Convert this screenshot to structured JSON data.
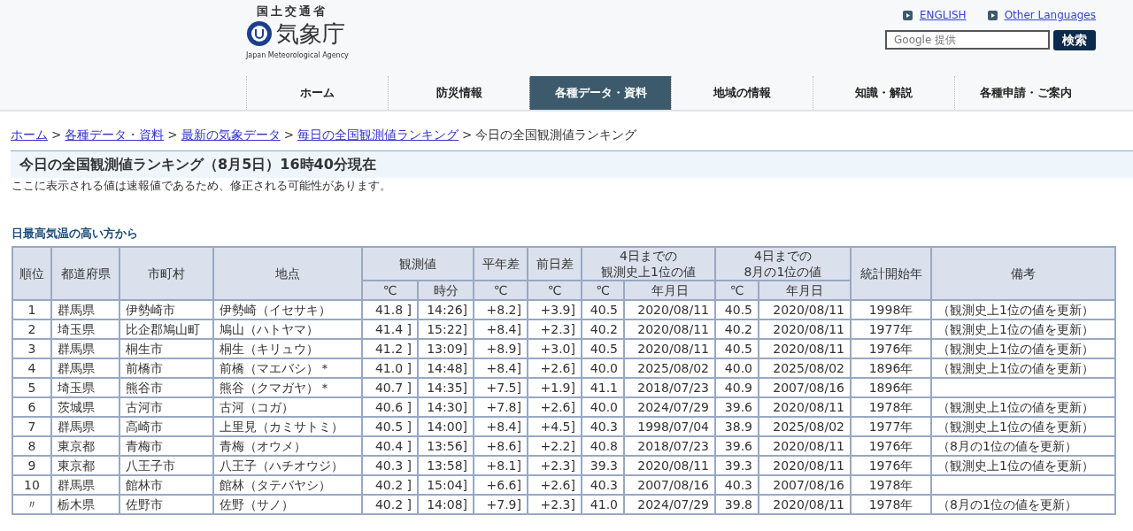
{
  "header": {
    "ministry": "国土交通省",
    "agency": "気象庁",
    "agency_en": "Japan Meteorological Agency",
    "links": [
      {
        "label": "ENGLISH"
      },
      {
        "label": "Other Languages"
      }
    ],
    "search": {
      "placeholder": "Google 提供",
      "button": "検索"
    }
  },
  "nav": [
    {
      "label": "ホーム",
      "selected": false
    },
    {
      "label": "防災情報",
      "selected": false
    },
    {
      "label": "各種データ・資料",
      "selected": true
    },
    {
      "label": "地域の情報",
      "selected": false
    },
    {
      "label": "知識・解説",
      "selected": false
    },
    {
      "label": "各種申請・ご案内",
      "selected": false
    }
  ],
  "breadcrumb": {
    "links": [
      "ホーム",
      "各種データ・資料",
      "最新の気象データ",
      "毎日の全国観測値ランキング"
    ],
    "separator": ">",
    "current": "今日の全国観測値ランキング"
  },
  "title": "今日の全国観測値ランキング（8月5日）16時40分現在",
  "notice": "ここに表示される値は速報値であるため、修正される可能性があります。",
  "section_title": "日最高気温の高い方から",
  "table": {
    "header_rows": [
      [
        {
          "lines": [
            "順位"
          ],
          "rowspan": 2
        },
        {
          "lines": [
            "都道府県"
          ],
          "rowspan": 2
        },
        {
          "lines": [
            "市町村"
          ],
          "rowspan": 2
        },
        {
          "lines": [
            "地点"
          ],
          "rowspan": 2
        },
        {
          "lines": [
            "観測値"
          ],
          "colspan": 2
        },
        {
          "lines": [
            "平年差"
          ]
        },
        {
          "lines": [
            "前日差"
          ]
        },
        {
          "lines": [
            "4日までの",
            "観測史上1位の値"
          ],
          "colspan": 2
        },
        {
          "lines": [
            "4日までの",
            "8月の1位の値"
          ],
          "colspan": 2
        },
        {
          "lines": [
            "統計開始年"
          ],
          "rowspan": 2
        },
        {
          "lines": [
            "備考"
          ],
          "rowspan": 2
        }
      ],
      [
        {
          "lines": [
            "℃"
          ]
        },
        {
          "lines": [
            "時分"
          ]
        },
        {
          "lines": [
            "℃"
          ]
        },
        {
          "lines": [
            "℃"
          ]
        },
        {
          "lines": [
            "℃"
          ]
        },
        {
          "lines": [
            "年月日"
          ]
        },
        {
          "lines": [
            "℃"
          ]
        },
        {
          "lines": [
            "年月日"
          ]
        }
      ]
    ],
    "rows": [
      {
        "cells": [
          "1",
          "群馬県",
          "伊勢崎市",
          "伊勢崎（イセサキ）",
          "41.8 ]",
          "14:26]",
          "+8.2]",
          "+3.9]",
          "40.5",
          "2020/08/11",
          "40.5",
          "2020/08/11",
          "1998年"
        ],
        "remark": "（観測史上1位の値を更新）"
      },
      {
        "cells": [
          "2",
          "埼玉県",
          "比企郡鳩山町",
          "鳩山（ハトヤマ）",
          "41.4 ]",
          "15:22]",
          "+8.4]",
          "+2.3]",
          "40.2",
          "2020/08/11",
          "40.2",
          "2020/08/11",
          "1977年"
        ],
        "remark": "（観測史上1位の値を更新）"
      },
      {
        "cells": [
          "3",
          "群馬県",
          "桐生市",
          "桐生（キリュウ）",
          "41.2 ]",
          "13:09]",
          "+8.9]",
          "+3.0]",
          "40.5",
          "2020/08/11",
          "40.5",
          "2020/08/11",
          "1976年"
        ],
        "remark": "（観測史上1位の値を更新）"
      },
      {
        "cells": [
          "4",
          "群馬県",
          "前橋市",
          "前橋（マエバシ）＊",
          "41.0 ]",
          "14:48]",
          "+8.4]",
          "+2.6]",
          "40.0",
          "2025/08/02",
          "40.0",
          "2025/08/02",
          "1896年"
        ],
        "remark": "（観測史上1位の値を更新）"
      },
      {
        "cells": [
          "5",
          "埼玉県",
          "熊谷市",
          "熊谷（クマガヤ）＊",
          "40.7 ]",
          "14:35]",
          "+7.5]",
          "+1.9]",
          "41.1",
          "2018/07/23",
          "40.9",
          "2007/08/16",
          "1896年"
        ]
      },
      {
        "cells": [
          "6",
          "茨城県",
          "古河市",
          "古河（コガ）",
          "40.6 ]",
          "14:30]",
          "+7.8]",
          "+2.6]",
          "40.0",
          "2024/07/29",
          "39.6",
          "2020/08/11",
          "1978年"
        ],
        "remark": "（観測史上1位の値を更新）"
      },
      {
        "cells": [
          "7",
          "群馬県",
          "高崎市",
          "上里見（カミサトミ）",
          "40.5 ]",
          "14:00]",
          "+8.4]",
          "+4.5]",
          "40.3",
          "1998/07/04",
          "38.9",
          "2025/08/02",
          "1977年"
        ],
        "remark": "（観測史上1位の値を更新）"
      },
      {
        "cells": [
          "8",
          "東京都",
          "青梅市",
          "青梅（オウメ）",
          "40.4 ]",
          "13:56]",
          "+8.6]",
          "+2.2]",
          "40.8",
          "2018/07/23",
          "39.6",
          "2020/08/11",
          "1976年"
        ],
        "remark": "（8月の1位の値を更新）"
      },
      {
        "cells": [
          "9",
          "東京都",
          "八王子市",
          "八王子（ハチオウジ）",
          "40.3 ]",
          "13:58]",
          "+8.1]",
          "+2.3]",
          "39.3",
          "2020/08/11",
          "39.3",
          "2020/08/11",
          "1976年"
        ],
        "remark": "（観測史上1位の値を更新）"
      },
      {
        "cells": [
          "10",
          "群馬県",
          "館林市",
          "館林（タテバヤシ）",
          "40.2 ]",
          "15:04]",
          "+6.6]",
          "+2.6]",
          "40.3",
          "2007/08/16",
          "40.3",
          "2007/08/16",
          "1978年"
        ]
      },
      {
        "cells": [
          "〃",
          "栃木県",
          "佐野市",
          "佐野（サノ）",
          "40.2 ]",
          "14:08]",
          "+7.9]",
          "+2.3]",
          "41.0",
          "2024/07/29",
          "39.8",
          "2020/08/11",
          "1978年"
        ],
        "remark": "（8月の1位の値を更新）"
      }
    ]
  }
}
